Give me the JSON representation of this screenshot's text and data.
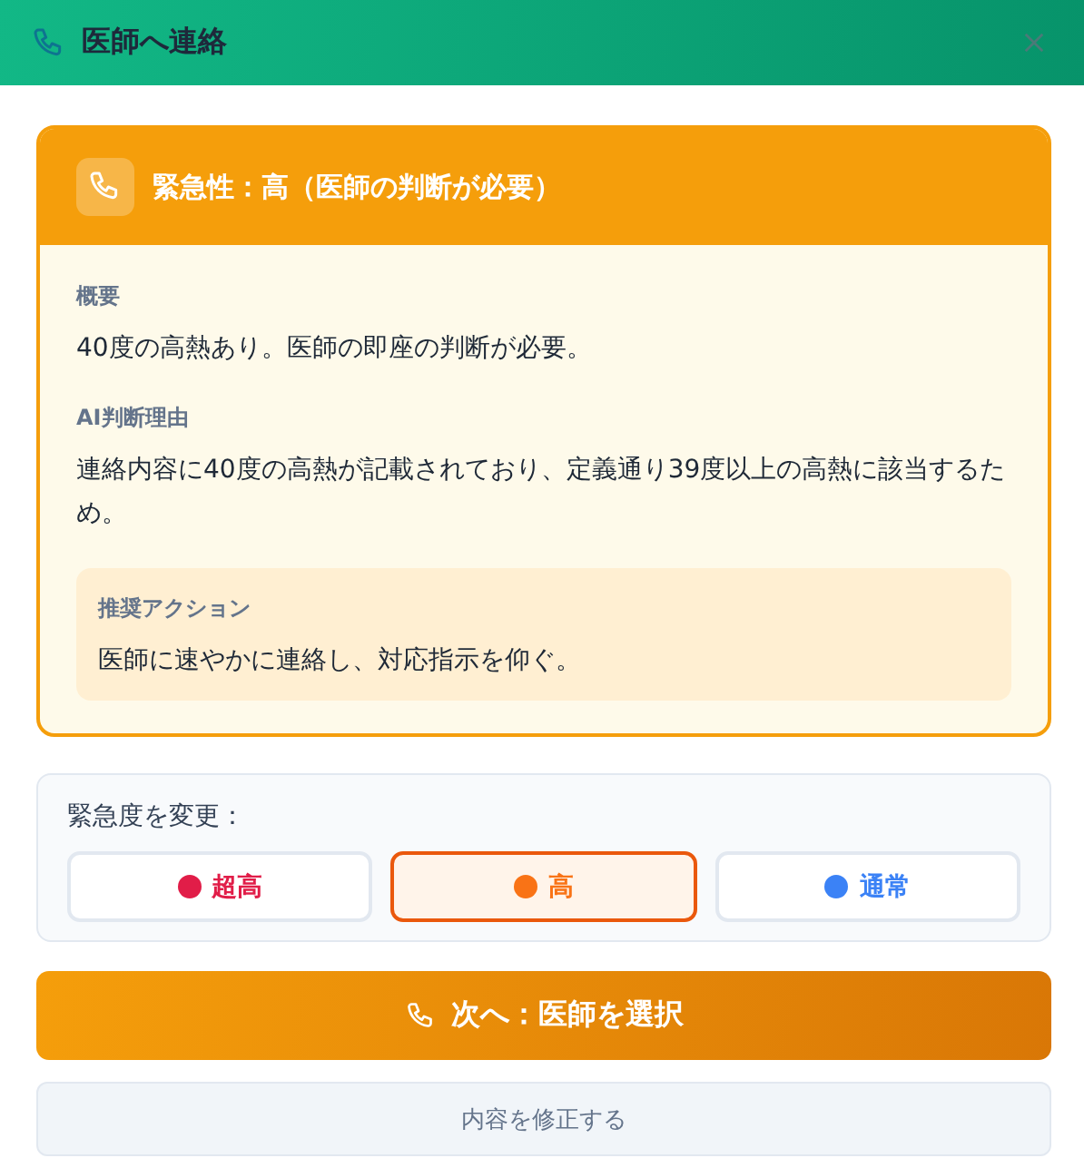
{
  "dialog": {
    "title": "医師へ連絡"
  },
  "urgency_card": {
    "title": "緊急性：高（医師の判断が必要）",
    "sections": [
      {
        "label": "概要",
        "text": "40度の高熱あり。医師の即座の判断が必要。"
      },
      {
        "label": "AI判断理由",
        "text": "連絡内容に40度の高熱が記載されており、定義通り39度以上の高熱に該当するため。"
      }
    ],
    "recommendation": {
      "label": "推奨アクション",
      "text": "医師に速やかに連絡し、対応指示を仰ぐ。"
    }
  },
  "change_urgency": {
    "label": "緊急度を変更：",
    "options": [
      {
        "label": "超高",
        "color": "#e11d48",
        "selected": false
      },
      {
        "label": "高",
        "color": "#f97316",
        "selected": true
      },
      {
        "label": "通常",
        "color": "#3b82f6",
        "selected": false
      }
    ]
  },
  "primary_button": "次へ：医師を選択",
  "secondary_button": "内容を修正する"
}
